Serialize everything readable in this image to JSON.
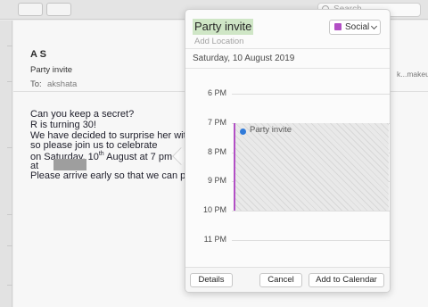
{
  "toolbar": {
    "search_placeholder": "Search"
  },
  "message": {
    "sender": "A S",
    "subject": "Party invite",
    "to_label": "To:",
    "to_value": "akshata",
    "recipient_partial": "k...makeuse",
    "body": {
      "line1": "Can you keep a secret?",
      "line2": "R is turning 30!",
      "line3": "We have decided to surprise her with a",
      "line4": "so please join us to celebrate",
      "line5_prefix": "on Saturday, 10",
      "line5_sup": "th",
      "line5_suffix": " August at 7 pm",
      "line6": "at",
      "line7": "Please arrive early so that we can prep"
    }
  },
  "popover": {
    "title": "Party invite",
    "location_placeholder": "Add Location",
    "calendar": "Social",
    "date": "Saturday, 10 August 2019",
    "hours": [
      "6 PM",
      "7 PM",
      "8 PM",
      "9 PM",
      "10 PM",
      "11 PM"
    ],
    "event_label": "Party invite",
    "buttons": {
      "details": "Details",
      "cancel": "Cancel",
      "add": "Add to Calendar"
    }
  },
  "colors": {
    "calendar_social": "#b24fc5",
    "title_highlight": "#cfe6c6",
    "event_dot": "#2f7ad9"
  },
  "icons": {
    "search": "search-icon",
    "calendar_color": "calendar-swatch-icon",
    "dropdown": "chevron-down-icon"
  }
}
